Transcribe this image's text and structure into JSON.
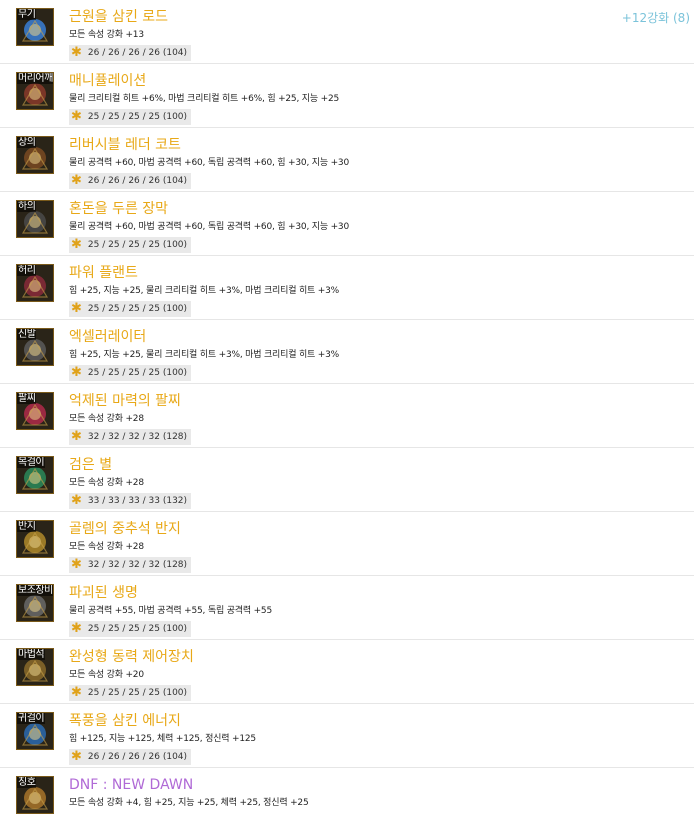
{
  "items": [
    {
      "slot": "무기",
      "name": "근원을 삼킨 로드",
      "options": "모든 속성 강화 +13",
      "stats": "26 / 26 / 26 / 26 (104)",
      "upgrade": "+12강화 (8)",
      "icon": "rod-icon",
      "color": "#3a7fd6"
    },
    {
      "slot": "머리어깨",
      "name": "매니퓰레이션",
      "options": "물리 크리티컬 히트 +6%, 마법 크리티컬 히트 +6%, 힘 +25, 지능 +25",
      "stats": "25 / 25 / 25 / 25 (100)",
      "icon": "shoulder-armor-icon",
      "color": "#8a3a2a"
    },
    {
      "slot": "상의",
      "name": "리버시블 레더 코트",
      "options": "물리 공격력 +60, 마법 공격력 +60, 독립 공격력 +60, 힘 +30, 지능 +30",
      "stats": "26 / 26 / 26 / 26 (104)",
      "icon": "coat-icon",
      "color": "#7a4a22"
    },
    {
      "slot": "하의",
      "name": "혼돈을 두른 장막",
      "options": "물리 공격력 +60, 마법 공격력 +60, 독립 공격력 +60, 힘 +30, 지능 +30",
      "stats": "25 / 25 / 25 / 25 (100)",
      "icon": "pants-icon",
      "color": "#4a4a4a"
    },
    {
      "slot": "허리",
      "name": "파워 플랜트",
      "options": "힘 +25, 지능 +25, 물리 크리티컬 히트 +3%, 마법 크리티컬 히트 +3%",
      "stats": "25 / 25 / 25 / 25 (100)",
      "icon": "belt-icon",
      "color": "#8a2a3a"
    },
    {
      "slot": "신발",
      "name": "엑셀러레이터",
      "options": "힘 +25, 지능 +25, 물리 크리티컬 히트 +3%, 마법 크리티컬 히트 +3%",
      "stats": "25 / 25 / 25 / 25 (100)",
      "icon": "boots-icon",
      "color": "#5a5a5a"
    },
    {
      "slot": "팔찌",
      "name": "억제된 마력의 팔찌",
      "options": "모든 속성 강화 +28",
      "stats": "32 / 32 / 32 / 32 (128)",
      "icon": "bracelet-icon",
      "color": "#b02a4a"
    },
    {
      "slot": "목걸이",
      "name": "검은 별",
      "options": "모든 속성 강화 +28",
      "stats": "33 / 33 / 33 / 33 (132)",
      "icon": "necklace-icon",
      "color": "#2a8a5a"
    },
    {
      "slot": "반지",
      "name": "골렘의 중추석 반지",
      "options": "모든 속성 강화 +28",
      "stats": "32 / 32 / 32 / 32 (128)",
      "icon": "ring-icon",
      "color": "#b08a2a"
    },
    {
      "slot": "보조장비",
      "name": "파괴된 생명",
      "options": "물리 공격력 +55, 마법 공격력 +55, 독립 공격력 +55",
      "stats": "25 / 25 / 25 / 25 (100)",
      "icon": "support-gear-icon",
      "color": "#6a6a6a"
    },
    {
      "slot": "마법석",
      "name": "완성형 동력 제어장치",
      "options": "모든 속성 강화 +20",
      "stats": "25 / 25 / 25 / 25 (100)",
      "icon": "magic-stone-icon",
      "color": "#8a6a2a"
    },
    {
      "slot": "귀걸이",
      "name": "폭풍을 삼킨 에너지",
      "options": "힘 +125, 지능 +125, 체력 +125, 정신력 +125",
      "stats": "26 / 26 / 26 / 26 (104)",
      "icon": "earring-icon",
      "color": "#2a6ab0"
    },
    {
      "slot": "칭호",
      "name": "DNF : NEW DAWN",
      "options": "모든 속성 강화 +4, 힘 +25, 지능 +25, 체력 +25, 정신력 +25",
      "icon": "title-icon",
      "color": "#a8742a"
    }
  ]
}
